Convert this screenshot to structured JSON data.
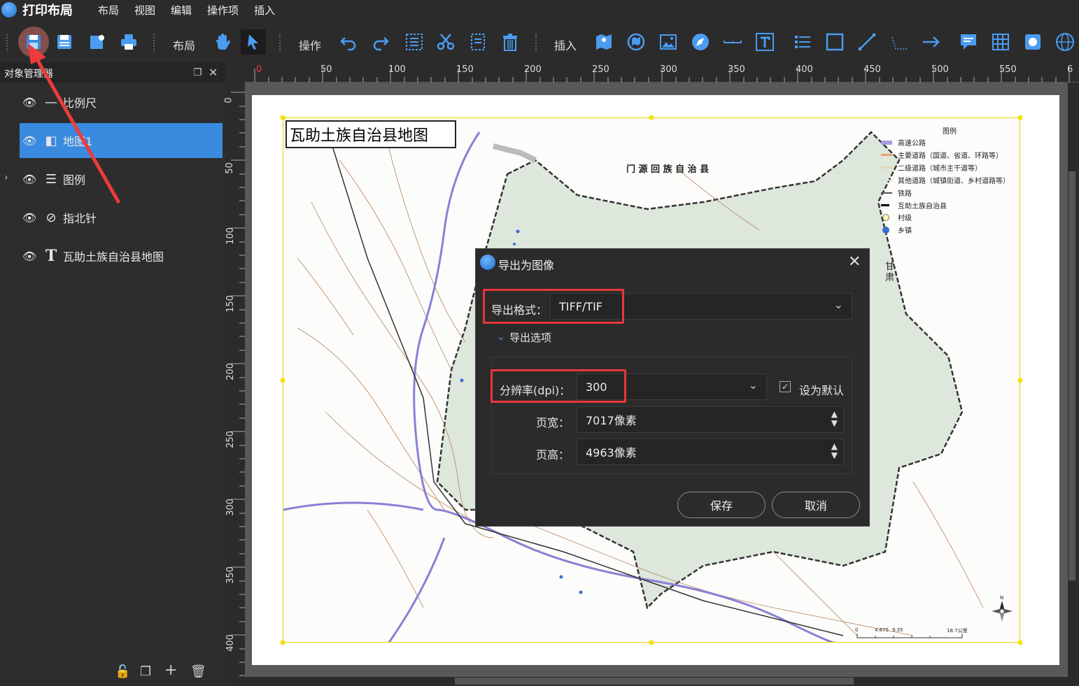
{
  "app": {
    "title": "打印布局"
  },
  "menu": [
    "布局",
    "视图",
    "编辑",
    "操作项",
    "插入"
  ],
  "toolbar": {
    "layout_label": "布局",
    "ops_label": "操作",
    "insert_label": "插入"
  },
  "panel": {
    "title": "对象管理器",
    "items": [
      "比例尺",
      "地图1",
      "图例",
      "指北针",
      "瓦助土族自治县地图"
    ]
  },
  "ruler": {
    "h": [
      "0",
      "50",
      "100",
      "150",
      "200",
      "250",
      "300",
      "350",
      "400",
      "450",
      "500",
      "550",
      "6"
    ],
    "v": [
      "0",
      "50",
      "100",
      "150",
      "200",
      "250",
      "300",
      "350",
      "400"
    ]
  },
  "map": {
    "title": "瓦助土族自治县地图",
    "label_menyuan": "门 源 回 族 自 治 县",
    "label_gansu": "甘\n肃",
    "legend_title": "图例",
    "legend": [
      "高速公路",
      "主要道路（国道、省道、环路等）",
      "二级道路（城市主干道等）",
      "其他道路（城镇街道、乡村道路等）",
      "铁路",
      "互助土族自治县",
      "村级",
      "乡镇"
    ],
    "scale": [
      "0",
      "4.675",
      "9.35",
      "18.7公里"
    ],
    "north": "N"
  },
  "dialog": {
    "title": "导出为图像",
    "format_label": "导出格式：",
    "format_value": "TIFF/TIF",
    "options_label": "导出选项",
    "dpi_label": "分辨率(dpi)：",
    "dpi_value": "300",
    "default_label": "设为默认",
    "width_label": "页宽：",
    "width_value": "7017像素",
    "height_label": "页高：",
    "height_value": "4963像素",
    "save": "保存",
    "cancel": "取消"
  },
  "colors": {
    "accent": "#3a8be0",
    "highlight": "#e8373a",
    "frame": "#e6d000",
    "region": "#dde7dc"
  }
}
